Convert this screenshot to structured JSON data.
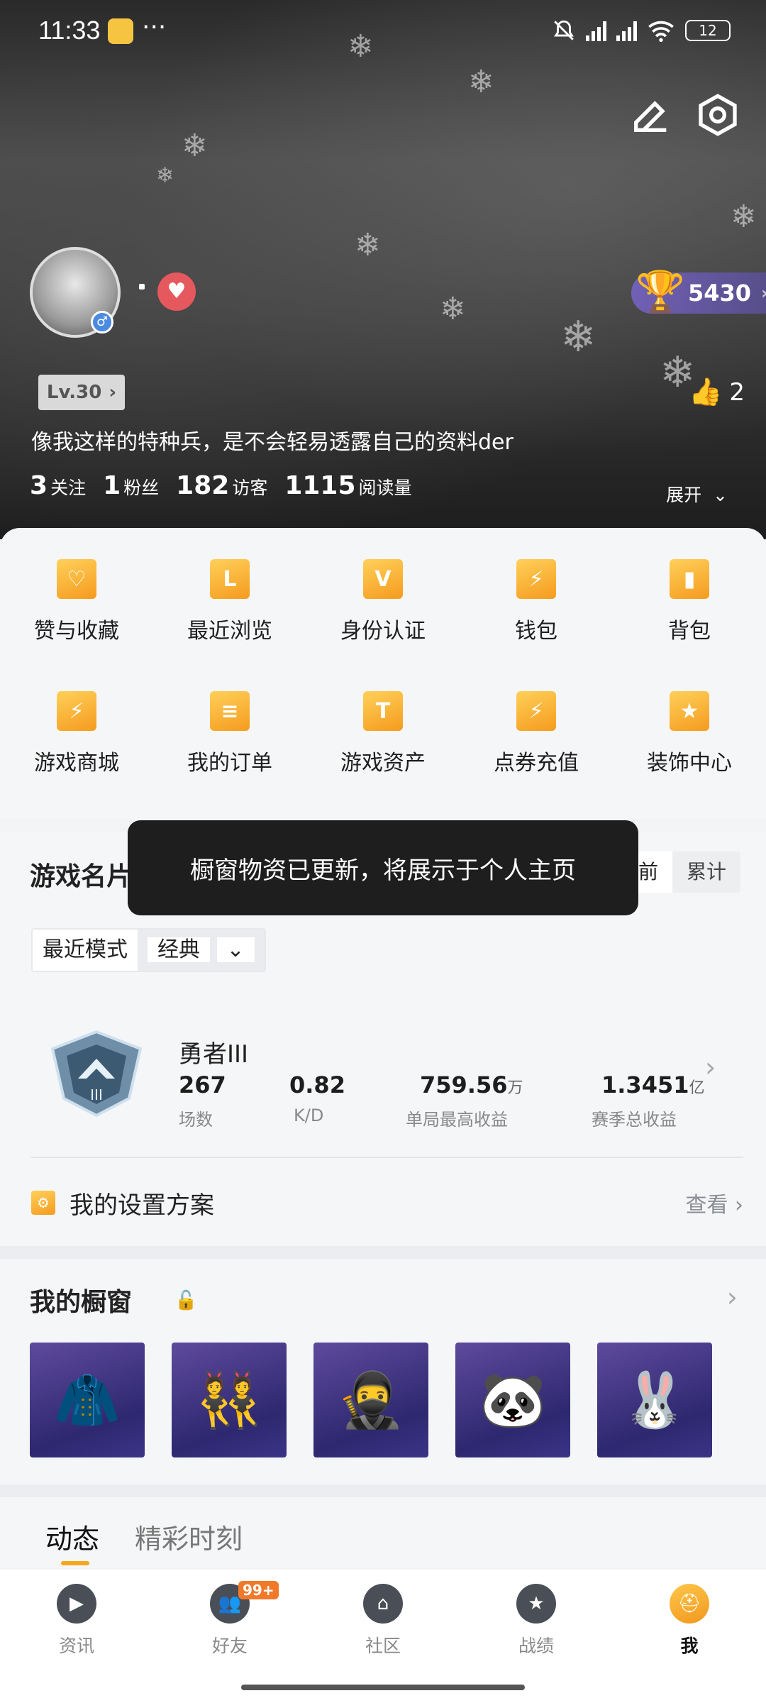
{
  "status_bar": {
    "time": "11:33",
    "dots": "···",
    "battery": "12"
  },
  "profile": {
    "trophy_score": "5430",
    "level": "Lv.30",
    "likes": "2",
    "bio": "像我这样的特种兵，是不会轻易透露自己的资料der",
    "stats": [
      {
        "value": "3",
        "label": "关注"
      },
      {
        "value": "1",
        "label": "粉丝"
      },
      {
        "value": "182",
        "label": "访客"
      },
      {
        "value": "1115",
        "label": "阅读量"
      }
    ],
    "expand_label": "展开"
  },
  "shortcuts": [
    {
      "label": "赞与收藏",
      "icon": "favorites-icon"
    },
    {
      "label": "最近浏览",
      "icon": "recent-icon"
    },
    {
      "label": "身份认证",
      "icon": "verify-icon"
    },
    {
      "label": "钱包",
      "icon": "wallet-icon"
    },
    {
      "label": "背包",
      "icon": "backpack-icon"
    },
    {
      "label": "游戏商城",
      "icon": "shop-icon"
    },
    {
      "label": "我的订单",
      "icon": "orders-icon"
    },
    {
      "label": "游戏资产",
      "icon": "assets-icon"
    },
    {
      "label": "点券充值",
      "icon": "recharge-icon"
    },
    {
      "label": "装饰中心",
      "icon": "decor-icon"
    }
  ],
  "game_card": {
    "title": "游戏名片",
    "toggle": {
      "current": "当前",
      "total": "累计"
    },
    "toast": "橱窗物资已更新，将展示于个人主页",
    "mode_label": "最近模式",
    "mode_value": "经典",
    "rank_name": "勇者III",
    "rank_stats": [
      {
        "value": "267",
        "unit": "",
        "label": "场数"
      },
      {
        "value": "0.82",
        "unit": "",
        "label": "K/D"
      },
      {
        "value": "759.56",
        "unit": "万",
        "label": "单局最高收益"
      },
      {
        "value": "1.3451",
        "unit": "亿",
        "label": "赛季总收益"
      }
    ],
    "plan_label": "我的设置方案",
    "plan_action": "查看"
  },
  "showcase": {
    "title": "我的橱窗",
    "item_count": 5
  },
  "feed_tabs": {
    "active": "动态",
    "other": "精彩时刻"
  },
  "bottom_nav": [
    {
      "label": "资讯"
    },
    {
      "label": "好友",
      "badge": "99+"
    },
    {
      "label": "社区"
    },
    {
      "label": "战绩"
    },
    {
      "label": "我"
    }
  ],
  "colors": {
    "accent": "#f5a81e",
    "toast_bg": "#1e1e1e",
    "heart": "#e5585e"
  }
}
